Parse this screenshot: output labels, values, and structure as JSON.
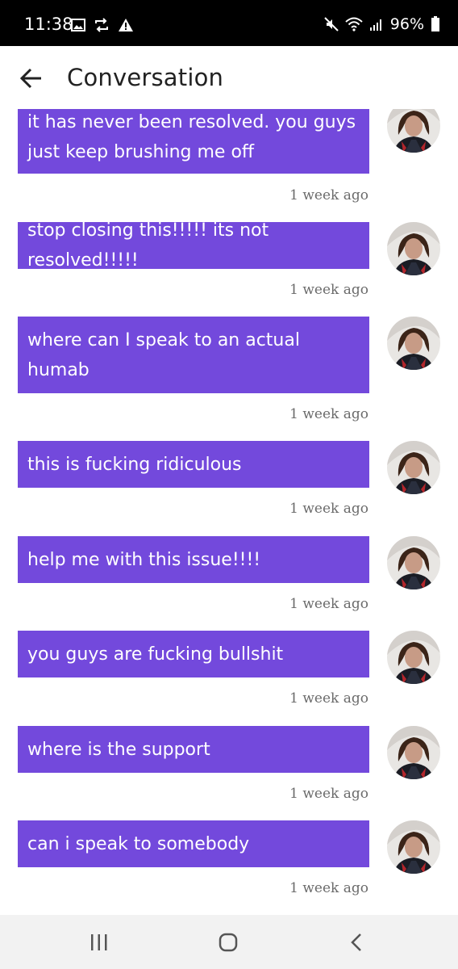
{
  "status_bar": {
    "time": "11:38",
    "battery": "96%"
  },
  "header": {
    "title": "Conversation"
  },
  "messages": [
    {
      "text": "it has never been resolved. you guys just keep brushing me off",
      "time": "1 week ago"
    },
    {
      "text": "stop closing this!!!!! its not resolved!!!!!",
      "time": "1 week ago"
    },
    {
      "text": "where can I speak to an actual humab",
      "time": "1 week ago"
    },
    {
      "text": "this is fucking ridiculous",
      "time": "1 week ago"
    },
    {
      "text": "help me with this issue!!!!",
      "time": "1 week ago"
    },
    {
      "text": "you guys are fucking bullshit",
      "time": "1 week ago"
    },
    {
      "text": "where is the support",
      "time": "1 week ago"
    },
    {
      "text": "can i speak to somebody",
      "time": "1 week ago"
    }
  ],
  "colors": {
    "bubble": "#7349dc",
    "status_bar": "#000000",
    "nav_bar": "#f2f2f2"
  }
}
